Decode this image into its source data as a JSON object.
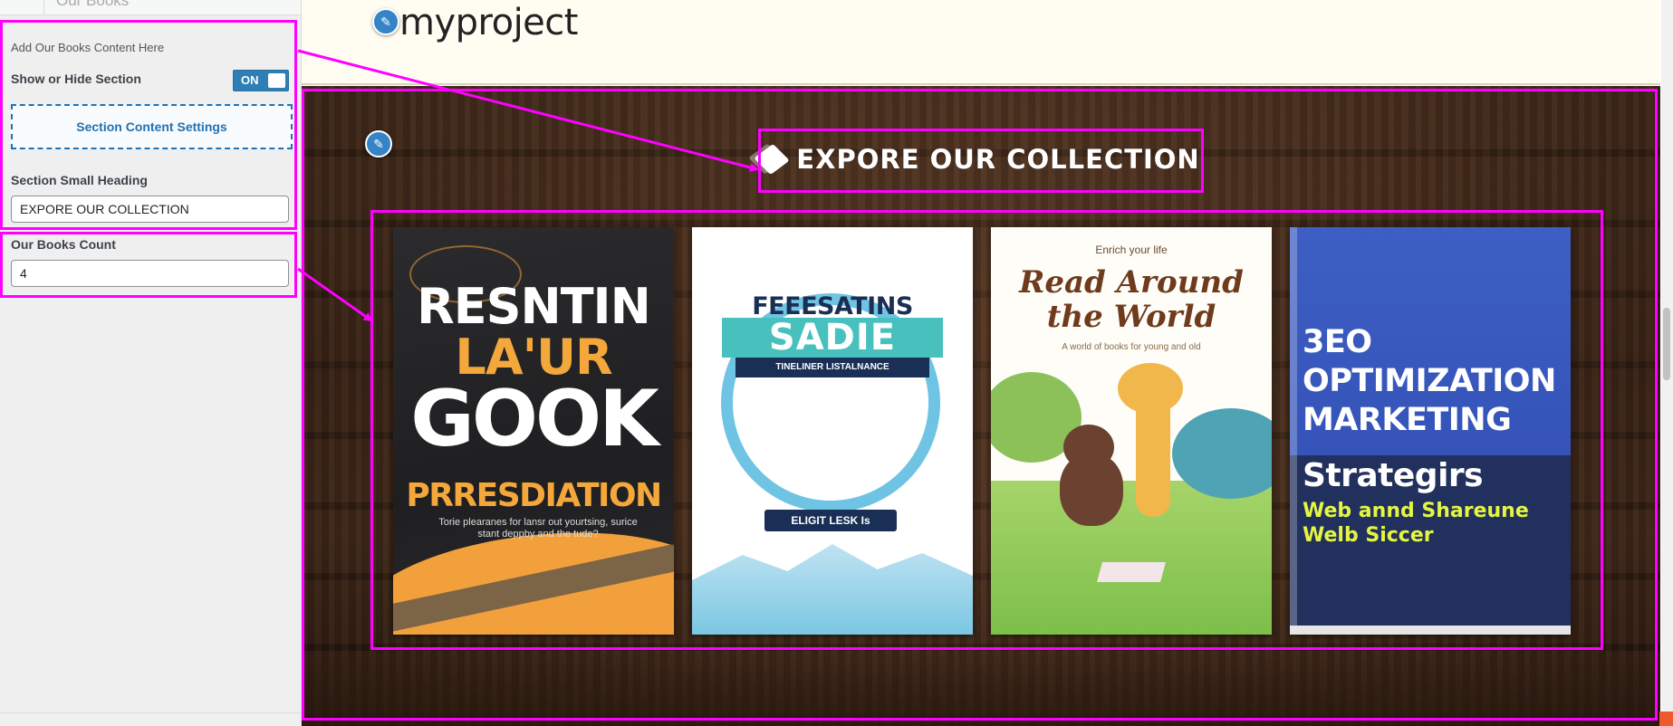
{
  "sidebar": {
    "top_item_label": "Our Books",
    "description": "Add Our Books Content Here",
    "show_hide_label": "Show or Hide Section",
    "toggle_label": "ON",
    "section_settings_label": "Section Content Settings",
    "small_heading_label": "Section Small Heading",
    "small_heading_value": "EXPORE OUR COLLECTION",
    "books_count_label": "Our Books Count",
    "books_count_value": "4"
  },
  "preview": {
    "site_title": "myproject",
    "edit_icon": "pencil-icon",
    "section_heading": "EXPORE OUR COLLECTION",
    "books": [
      {
        "line1": "RESNTIN",
        "line2": "LA'UR",
        "line3": "GOOK",
        "line4": "PRRESDIATION",
        "line5": "Torie plearanes for lansr out yourtsing, surice stant deppby and the tude?"
      },
      {
        "line1": "FEEESATINS",
        "line2": "SADIE",
        "line3": "TINELINER LISTALNANCE",
        "line4": "ELIGIT LESK Is"
      },
      {
        "line1": "Enrich your life",
        "line2": "Read Around the World",
        "line3": "A world of books for young and old"
      },
      {
        "line1": "3EO OPTIMIZATION MARKETING",
        "line2": "Strategirs",
        "line3": "Web annd Shareune Welb Siccer"
      }
    ]
  },
  "colors": {
    "highlight": "#ff00ff",
    "toggle_on": "#2f7fb7",
    "link_blue": "#2271b1",
    "edit_dot": "#3584c7",
    "accent_orange": "#f4a73b"
  }
}
